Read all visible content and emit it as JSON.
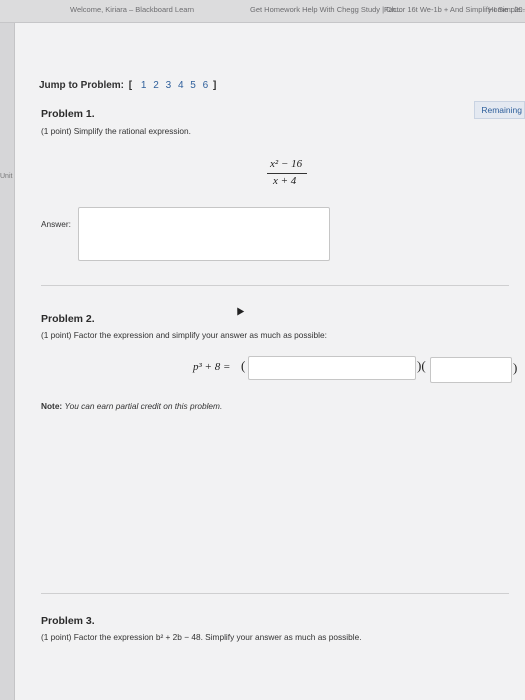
{
  "browser": {
    "tabs": [
      {
        "label": "Welcome, Kiriara – Blackboard Learn"
      },
      {
        "label": "Get Homework Help With Chegg Study | Ch..."
      },
      {
        "label": "Factor 16t We-1b + And Simplify I Simple..."
      },
      {
        "label": "Home : 20-2-Mat"
      }
    ]
  },
  "sidebar": {
    "label": "Unit"
  },
  "remaining_label": "Remaining",
  "jump": {
    "label": "Jump to Problem:",
    "open": "[",
    "close": "]",
    "numbers": [
      "1",
      "2",
      "3",
      "4",
      "5",
      "6"
    ]
  },
  "problem1": {
    "title": "Problem 1.",
    "text": "(1 point) Simplify the rational expression.",
    "numerator": "x² − 16",
    "denominator": "x + 4",
    "answer_label": "Answer:",
    "answer_value": ""
  },
  "problem2": {
    "title": "Problem 2.",
    "text": "(1 point) Factor the expression and simplify your answer as much as possible:",
    "expr": "p³ + 8 =",
    "open_paren": "(",
    "mid_paren": ")(",
    "close_paren": ")",
    "note_bold": "Note:",
    "note_text": "You can earn partial credit on this problem.",
    "input1_value": "",
    "input2_value": ""
  },
  "problem3": {
    "title": "Problem 3.",
    "text": "(1 point) Factor the expression b² + 2b − 48. Simplify your answer as much as possible."
  }
}
